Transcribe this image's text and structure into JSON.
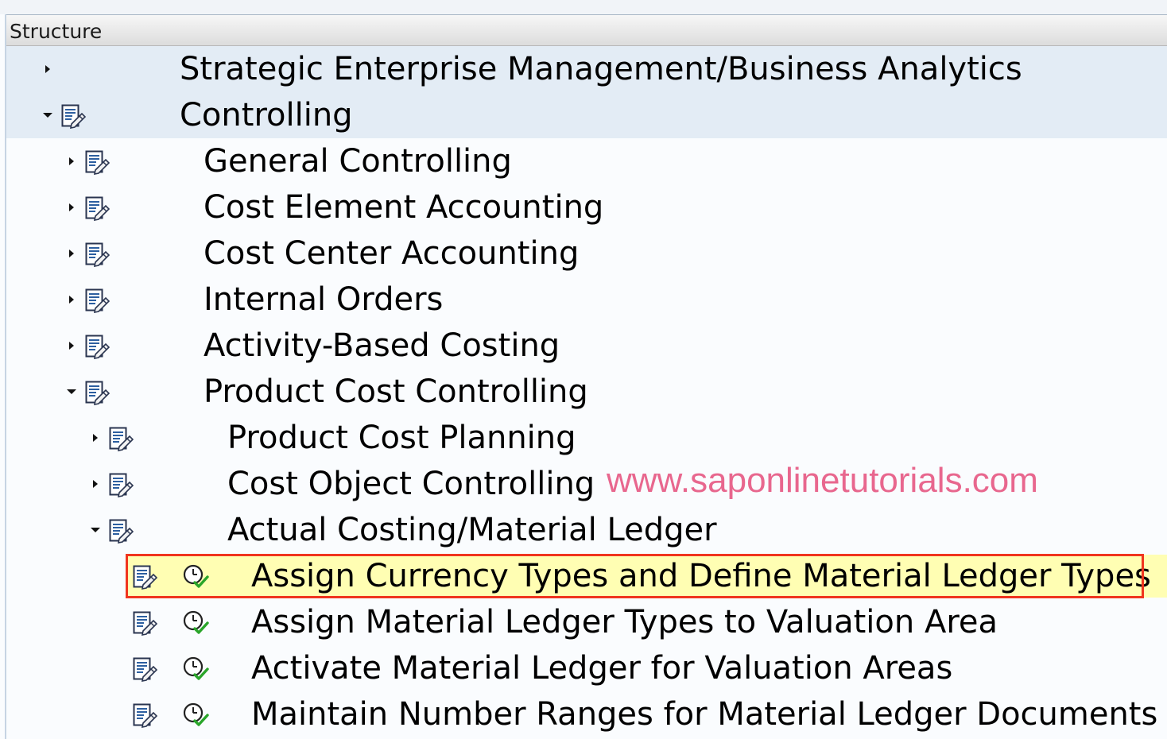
{
  "header": {
    "title": "Structure"
  },
  "tree": [
    {
      "label": "Strategic Enterprise Management/Business Analytics",
      "level": 0,
      "state": "collapsed",
      "icons": [],
      "selected": true
    },
    {
      "label": "Controlling",
      "level": 0,
      "state": "expanded",
      "icons": [
        "document-icon"
      ],
      "selected": true
    },
    {
      "label": "General Controlling",
      "level": 1,
      "state": "collapsed",
      "icons": [
        "document-icon"
      ]
    },
    {
      "label": "Cost Element Accounting",
      "level": 1,
      "state": "collapsed",
      "icons": [
        "document-icon"
      ]
    },
    {
      "label": "Cost Center Accounting",
      "level": 1,
      "state": "collapsed",
      "icons": [
        "document-icon"
      ]
    },
    {
      "label": "Internal Orders",
      "level": 1,
      "state": "collapsed",
      "icons": [
        "document-icon"
      ]
    },
    {
      "label": "Activity-Based Costing",
      "level": 1,
      "state": "collapsed",
      "icons": [
        "document-icon"
      ]
    },
    {
      "label": "Product Cost Controlling",
      "level": 1,
      "state": "expanded",
      "icons": [
        "document-icon"
      ]
    },
    {
      "label": "Product Cost Planning",
      "level": 2,
      "state": "collapsed",
      "icons": [
        "document-icon"
      ]
    },
    {
      "label": "Cost Object Controlling",
      "level": 2,
      "state": "collapsed",
      "icons": [
        "document-icon"
      ]
    },
    {
      "label": "Actual Costing/Material Ledger",
      "level": 2,
      "state": "expanded",
      "icons": [
        "document-icon"
      ]
    },
    {
      "label": "Assign Currency Types and Define Material Ledger Types",
      "level": 3,
      "state": "leaf",
      "icons": [
        "document-icon",
        "execute-clock-icon"
      ],
      "highlighted": true
    },
    {
      "label": "Assign Material Ledger Types to Valuation Area",
      "level": 3,
      "state": "leaf",
      "icons": [
        "document-icon",
        "execute-clock-icon"
      ]
    },
    {
      "label": "Activate Material Ledger for Valuation Areas",
      "level": 3,
      "state": "leaf",
      "icons": [
        "document-icon",
        "execute-clock-icon"
      ]
    },
    {
      "label": "Maintain Number Ranges for Material Ledger Documents",
      "level": 3,
      "state": "leaf",
      "icons": [
        "document-icon",
        "execute-clock-icon"
      ]
    }
  ],
  "watermark": "www.saponlinetutorials.com",
  "colors": {
    "highlight_border": "#f0351e",
    "highlight_fill": "#fffeb3",
    "selected_row": "#e3ecf5",
    "watermark": "#e8678e"
  }
}
